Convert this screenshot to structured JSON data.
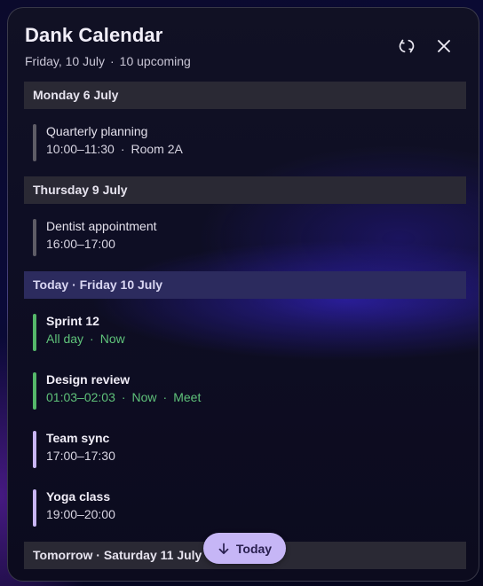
{
  "header": {
    "title": "Dank Calendar",
    "date": "Friday, 10 July",
    "separator": "·",
    "upcoming": "10 upcoming"
  },
  "icons": {
    "refresh": "refresh-icon",
    "close": "close-icon",
    "today": "arrow-down-icon"
  },
  "sections": [
    {
      "label": "Monday 6 July",
      "events": [
        {
          "name": "Quarterly planning",
          "time": "10:00–11:30",
          "details": [
            "Room 2A"
          ]
        }
      ]
    },
    {
      "label": "Thursday 9 July",
      "events": [
        {
          "name": "Dentist appointment",
          "time": "16:00–17:00",
          "details": []
        }
      ]
    },
    {
      "label": "Today · Friday 10 July",
      "events": [
        {
          "name": "Sprint 12",
          "time": "All day",
          "details": [
            "Now"
          ]
        },
        {
          "name": "Design review",
          "time": "01:03–02:03",
          "details": [
            "Now",
            "Meet"
          ]
        },
        {
          "name": "Team sync",
          "time": "17:00–17:30",
          "details": []
        },
        {
          "name": "Yoga class",
          "time": "19:00–20:00",
          "details": []
        }
      ]
    },
    {
      "label": "Tomorrow · Saturday 11 July",
      "events": []
    }
  ],
  "today_button": {
    "label": "Today"
  },
  "colors": {
    "past_bar": "#5e5c66",
    "active_bar": "#55b86a",
    "upcoming_bar": "#c9b6f5",
    "active_text": "#5fc27a",
    "accent": "#c6b6f6"
  }
}
